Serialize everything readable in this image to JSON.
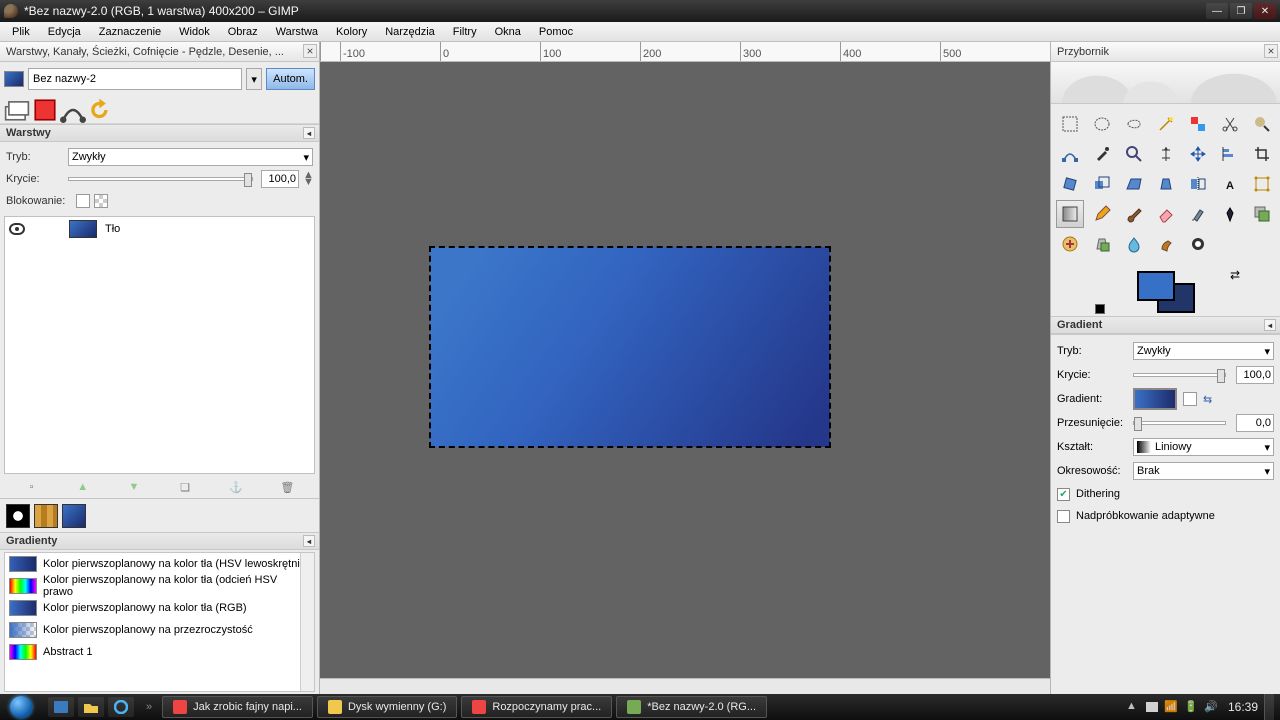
{
  "app_title": "*Bez nazwy-2.0 (RGB, 1 warstwa) 400x200 – GIMP",
  "menubar": [
    "Plik",
    "Edycja",
    "Zaznaczenie",
    "Widok",
    "Obraz",
    "Warstwa",
    "Kolory",
    "Narzędzia",
    "Filtry",
    "Okna",
    "Pomoc"
  ],
  "left_dock": {
    "title": "Warstwy, Kanały, Ścieżki, Cofnięcie - Pędzle, Desenie, ...",
    "image_name": "Bez nazwy-2",
    "autom": "Autom.",
    "layers": {
      "hdr": "Warstwy",
      "mode_label": "Tryb:",
      "mode_value": "Zwykły",
      "opacity_label": "Krycie:",
      "opacity_value": "100,0",
      "lock_label": "Blokowanie:",
      "layer0": "Tło"
    },
    "gradients": {
      "hdr": "Gradienty",
      "items": [
        "Kolor pierwszoplanowy na kolor tła (HSV lewoskrętnie)",
        "Kolor pierwszoplanowy na kolor tła (odcień HSV prawo",
        "Kolor pierwszoplanowy na kolor tła (RGB)",
        "Kolor pierwszoplanowy na przezroczystość",
        "Abstract 1"
      ]
    },
    "ruler_ticks": [
      "-100",
      "0",
      "100",
      "200",
      "300",
      "400",
      "500"
    ]
  },
  "toolbox": {
    "title": "Przybornik",
    "tools": [
      "rect-select-icon",
      "ellipse-select-icon",
      "free-select-icon",
      "wand-icon",
      "by-color-icon",
      "scissors-icon",
      "foreground-icon",
      "paths-icon",
      "color-picker-icon",
      "zoom-icon",
      "measure-icon",
      "move-icon",
      "align-icon",
      "crop-icon",
      "rotate-icon",
      "scale-icon",
      "shear-icon",
      "perspective-icon",
      "flip-icon",
      "text-icon",
      "cage-icon",
      "bucket-icon",
      "pencil-icon",
      "paintbrush-icon",
      "eraser-icon",
      "airbrush-icon",
      "ink-icon",
      "clone-icon",
      "heal-icon",
      "perspective-clone-icon",
      "blur-icon",
      "smudge-icon",
      "dodge-icon"
    ],
    "active": "bucket-icon",
    "gradient_options": {
      "hdr": "Gradient",
      "mode_label": "Tryb:",
      "mode_value": "Zwykły",
      "opacity_label": "Krycie:",
      "opacity_value": "100,0",
      "gradient_label": "Gradient:",
      "offset_label": "Przesunięcie:",
      "offset_value": "0,0",
      "shape_label": "Kształt:",
      "shape_value": "Liniowy",
      "repeat_label": "Okresowość:",
      "repeat_value": "Brak",
      "dither": "Dithering",
      "adaptive": "Nadpróbkowanie adaptywne"
    }
  },
  "taskbar": {
    "tasks": [
      {
        "label": "Jak zrobic fajny napi...",
        "color": "#e44"
      },
      {
        "label": "Dysk wymienny (G:)",
        "color": "#f0c84e"
      },
      {
        "label": "Rozpoczynamy prac...",
        "color": "#e44"
      },
      {
        "label": "*Bez nazwy-2.0 (RG...",
        "color": "#7a5"
      }
    ],
    "clock": "16:39"
  }
}
